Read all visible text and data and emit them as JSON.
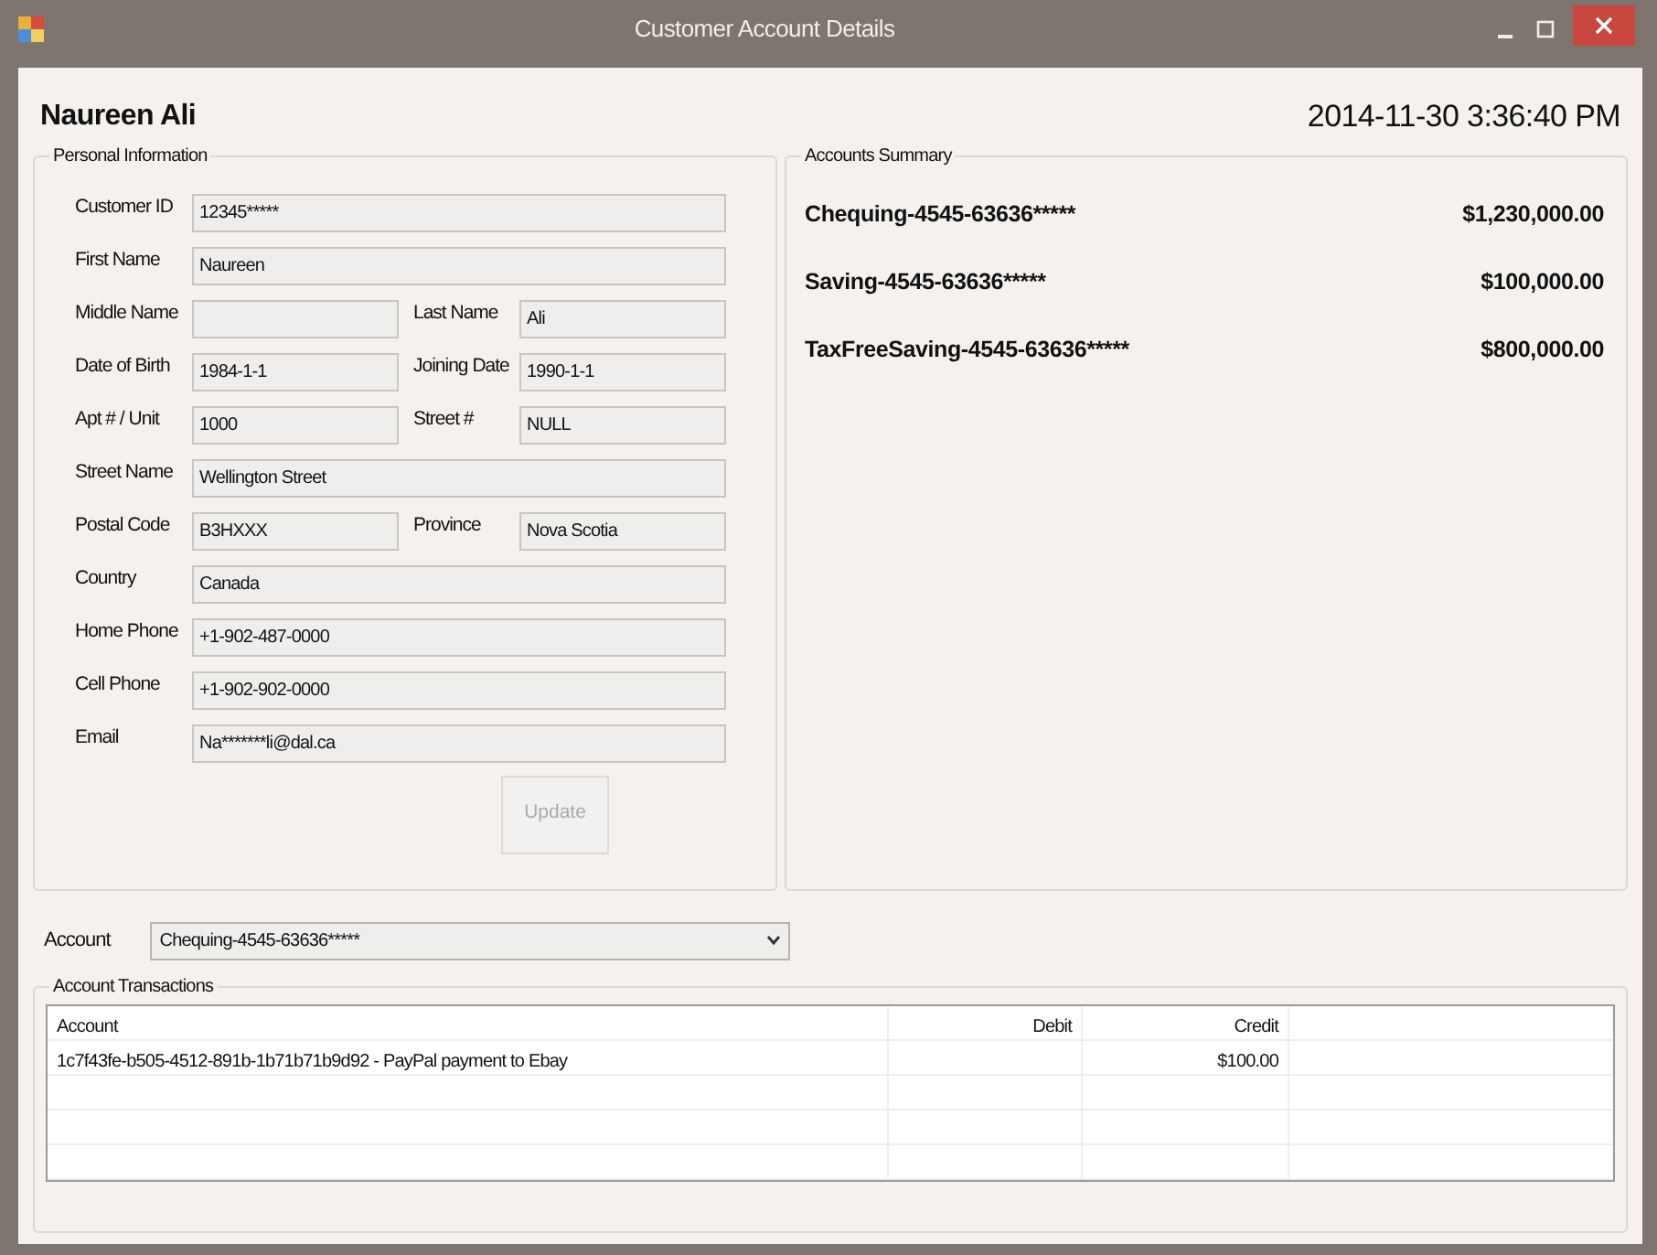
{
  "window": {
    "title": "Customer Account Details"
  },
  "customer_name": "Naureen  Ali",
  "datetime": "2014-11-30 3:36:40 PM",
  "personal_information": {
    "title": "Personal Information",
    "rows": [
      [
        {
          "label": "Customer ID",
          "value": "12345*****"
        }
      ],
      [
        {
          "label": "First Name",
          "value": "Naureen"
        }
      ],
      [
        {
          "label": "Middle Name"
        },
        {
          "label": "Last Name",
          "value": "Ali"
        }
      ],
      [
        {
          "label": "Date of Birth",
          "value": "1984-1-1"
        },
        {
          "label": "Joining Date",
          "value": "1990-1-1"
        }
      ],
      [
        {
          "label": "Apt # / Unit",
          "value": "1000"
        },
        {
          "label": "Street #",
          "value": "NULL"
        }
      ],
      [
        {
          "label": "Street Name",
          "value": "Wellington Street"
        }
      ],
      [
        {
          "label": "Postal Code",
          "value": "B3HXXX"
        },
        {
          "label": "Province",
          "value": "Nova Scotia"
        }
      ],
      [
        {
          "label": "Country",
          "value": "Canada"
        }
      ],
      [
        {
          "label": "Home Phone",
          "value": "+1-902-487-0000"
        }
      ],
      [
        {
          "label": "Cell Phone",
          "value": "+1-902-902-0000"
        }
      ],
      [
        {
          "label": "Email",
          "value": "Na*******li@dal.ca"
        }
      ]
    ],
    "update_button": {
      "label": "Update",
      "disabled": true
    }
  },
  "accounts_summary": {
    "title": "Accounts Summary",
    "accounts": [
      {
        "name": "Chequing-4545-63636*****",
        "balance": "$1,230,000.00"
      },
      {
        "name": "Saving-4545-63636*****",
        "balance": "$100,000.00"
      },
      {
        "name": "TaxFreeSaving-4545-63636*****",
        "balance": "$800,000.00"
      }
    ]
  },
  "account_select": {
    "label": "Account",
    "value": "Chequing-4545-63636*****"
  },
  "account_transactions": {
    "title": "Account Transactions",
    "columns": [
      "Account",
      "Debit",
      "Credit"
    ],
    "rows": [
      {
        "account": "1c7f43fe-b505-4512-891b-1b71b71b9d92 - PayPal payment to Ebay",
        "credit": "$100.00"
      }
    ]
  }
}
